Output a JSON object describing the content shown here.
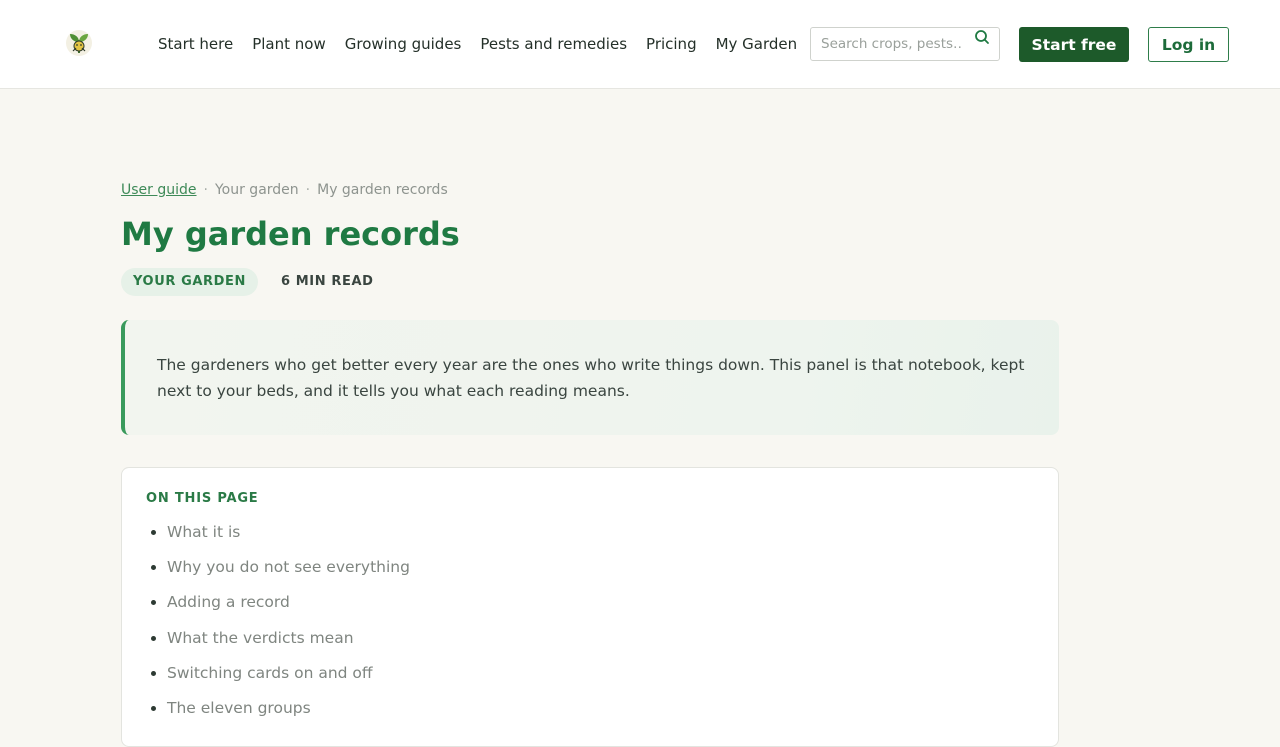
{
  "header": {
    "logo_icon": "sprout-icon",
    "nav": [
      {
        "label": "Start here"
      },
      {
        "label": "Plant now"
      },
      {
        "label": "Growing guides"
      },
      {
        "label": "Pests and remedies"
      },
      {
        "label": "Pricing"
      },
      {
        "label": "My Garden"
      }
    ],
    "search": {
      "placeholder": "Search crops, pests…",
      "value": "",
      "icon": "search-icon"
    },
    "start_label": "Start free",
    "login_label": "Log in"
  },
  "breadcrumb": {
    "items": [
      {
        "label": "User guide"
      },
      {
        "label": "Your garden"
      },
      {
        "label": "My garden records"
      }
    ],
    "separator": "·"
  },
  "page": {
    "title": "My garden records",
    "tag": "YOUR GARDEN",
    "read_time": "6 MIN READ",
    "intro": "The gardeners who get better every year are the ones who write things down. This panel is that notebook, kept next to your beds, and it tells you what each reading means."
  },
  "toc": {
    "heading": "ON THIS PAGE",
    "items": [
      {
        "label": "What it is"
      },
      {
        "label": "Why you do not see everything"
      },
      {
        "label": "Adding a record"
      },
      {
        "label": "What the verdicts mean"
      },
      {
        "label": "Switching cards on and off"
      },
      {
        "label": "The eleven groups"
      }
    ]
  },
  "colors": {
    "brand_green": "#1f7a43",
    "button_dark_green": "#1d5a2a",
    "page_background": "#f8f7f2"
  }
}
